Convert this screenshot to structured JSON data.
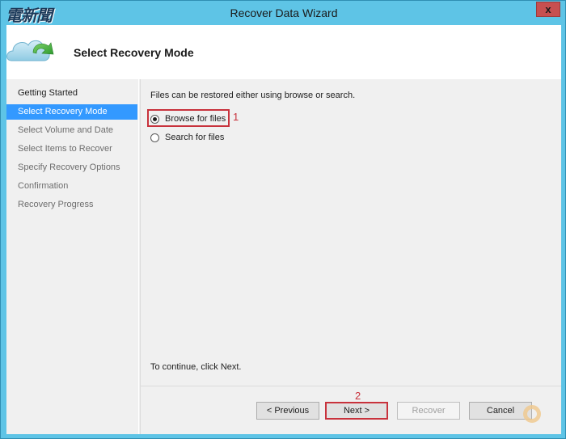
{
  "window": {
    "title": "Recover Data Wizard",
    "close_label": "x",
    "watermark_logo": "電新聞"
  },
  "header": {
    "icon": "cloud-recovery-icon",
    "title": "Select Recovery Mode"
  },
  "sidebar": {
    "items": [
      {
        "label": "Getting Started",
        "state": "done"
      },
      {
        "label": "Select Recovery Mode",
        "state": "active"
      },
      {
        "label": "Select Volume and Date",
        "state": "pending"
      },
      {
        "label": "Select Items to Recover",
        "state": "pending"
      },
      {
        "label": "Specify Recovery Options",
        "state": "pending"
      },
      {
        "label": "Confirmation",
        "state": "pending"
      },
      {
        "label": "Recovery Progress",
        "state": "pending"
      }
    ]
  },
  "content": {
    "intro": "Files can be restored either using browse or search.",
    "options": [
      {
        "label": "Browse for files",
        "checked": true
      },
      {
        "label": "Search for files",
        "checked": false
      }
    ],
    "continue_text": "To continue, click Next."
  },
  "annotations": {
    "step1": "1",
    "step2": "2",
    "color": "#c8323c"
  },
  "buttons": {
    "previous": "< Previous",
    "next": "Next >",
    "recover": "Recover",
    "cancel": "Cancel"
  }
}
